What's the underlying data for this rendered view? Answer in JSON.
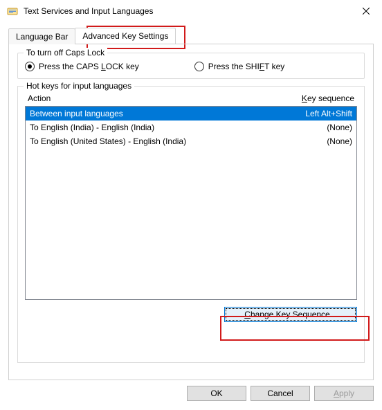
{
  "window": {
    "title": "Text Services and Input Languages"
  },
  "tabs": {
    "language_bar": "Language Bar",
    "advanced_key": "Advanced Key Settings"
  },
  "caps": {
    "legend": "To turn off Caps Lock",
    "opt1_pre": "Press the CAPS ",
    "opt1_u": "L",
    "opt1_post": "OCK key",
    "opt2_pre": "Press the SHI",
    "opt2_u": "F",
    "opt2_post": "T key"
  },
  "hotkeys": {
    "legend": "Hot keys for input languages",
    "col_action": "Action",
    "col_keyseq_pre": "",
    "col_keyseq_u": "K",
    "col_keyseq_post": "ey sequence",
    "rows": [
      {
        "action": "Between input languages",
        "keyseq": "Left Alt+Shift"
      },
      {
        "action": "To English (India) - English (India)",
        "keyseq": "(None)"
      },
      {
        "action": "To English (United States) - English (India)",
        "keyseq": "(None)"
      }
    ],
    "change_btn_u": "C",
    "change_btn_post": "hange Key Sequence..."
  },
  "footer": {
    "ok": "OK",
    "cancel": "Cancel",
    "apply_u": "A",
    "apply_post": "pply"
  }
}
